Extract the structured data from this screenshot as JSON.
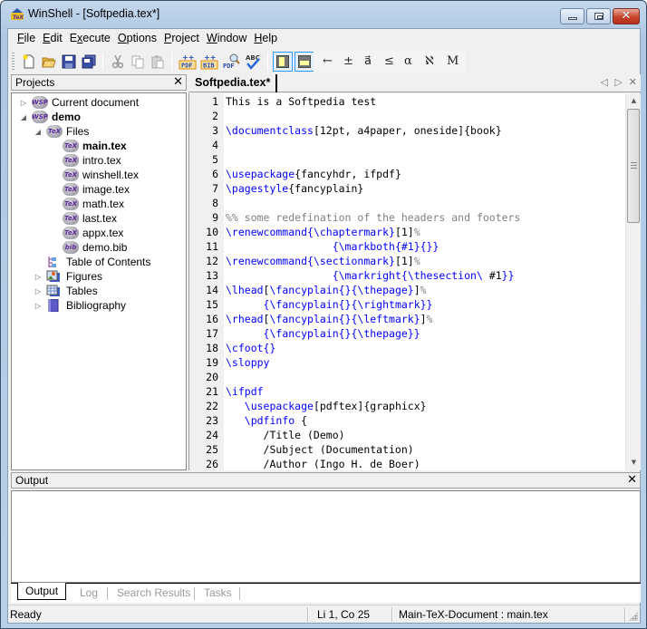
{
  "window": {
    "title": "WinShell - [Softpedia.tex*]",
    "app_icon": "winshell-tex-icon",
    "controls": {
      "minimize": "minimize",
      "maximize": "maximize",
      "close": "✕"
    }
  },
  "menubar": {
    "items": [
      {
        "accel": "F",
        "rest": "ile"
      },
      {
        "accel": "E",
        "rest": "dit"
      },
      {
        "pre": "E",
        "accel": "x",
        "rest": "ecute"
      },
      {
        "accel": "O",
        "rest": "ptions"
      },
      {
        "accel": "P",
        "rest": "roject"
      },
      {
        "accel": "W",
        "rest": "indow"
      },
      {
        "accel": "H",
        "rest": "elp"
      }
    ]
  },
  "toolbar": {
    "buttons": [
      {
        "name": "new-file",
        "icon": "new-file-icon"
      },
      {
        "name": "open-folder",
        "icon": "open-folder-icon"
      },
      {
        "name": "save",
        "icon": "save-icon"
      },
      {
        "name": "save-all",
        "icon": "save-all-icon"
      },
      {
        "name": "cut",
        "icon": "scissors-icon"
      },
      {
        "name": "copy",
        "icon": "copy-icon"
      },
      {
        "name": "paste",
        "icon": "paste-icon"
      },
      {
        "name": "pdflatex",
        "icon": "pdf-icon",
        "label": "PDF"
      },
      {
        "name": "bibtex",
        "icon": "bib-icon",
        "label": "BIB"
      },
      {
        "name": "pdf-view",
        "icon": "pdf-preview-icon",
        "label": "PDF"
      },
      {
        "name": "spell-check",
        "icon": "spellcheck-icon",
        "label": "ABC"
      },
      {
        "name": "toggle-project-panel",
        "icon": "panel-left-icon",
        "pressed": true
      },
      {
        "name": "toggle-output-panel",
        "icon": "panel-bottom-icon",
        "pressed": true
      }
    ],
    "symbols": [
      "←",
      "±",
      "a⃗",
      "≤",
      "α",
      "ℵ",
      "M"
    ]
  },
  "projects_panel": {
    "title": "Projects",
    "close": "✕",
    "tree": [
      {
        "label": "Current document",
        "icon": "wsp",
        "level": 0,
        "expander": "collapsed"
      },
      {
        "label": "demo",
        "icon": "wsp",
        "level": 0,
        "expander": "expanded",
        "bold": true
      },
      {
        "label": "Files",
        "icon": "tex",
        "level": 1,
        "expander": "expanded"
      },
      {
        "label": "main.tex",
        "icon": "tex",
        "level": 2,
        "bold": true
      },
      {
        "label": "intro.tex",
        "icon": "tex",
        "level": 2
      },
      {
        "label": "winshell.tex",
        "icon": "tex",
        "level": 2
      },
      {
        "label": "image.tex",
        "icon": "tex",
        "level": 2
      },
      {
        "label": "math.tex",
        "icon": "tex",
        "level": 2
      },
      {
        "label": "last.tex",
        "icon": "tex",
        "level": 2
      },
      {
        "label": "appx.tex",
        "icon": "tex",
        "level": 2
      },
      {
        "label": "demo.bib",
        "icon": "bib",
        "level": 2
      },
      {
        "label": "Table of Contents",
        "icon": "toc",
        "level": 1
      },
      {
        "label": "Figures",
        "icon": "figures",
        "level": 1,
        "expander": "collapsed"
      },
      {
        "label": "Tables",
        "icon": "tables",
        "level": 1,
        "expander": "collapsed"
      },
      {
        "label": "Bibliography",
        "icon": "bibliography",
        "level": 1,
        "expander": "collapsed"
      }
    ]
  },
  "editor": {
    "tab_label": "Softpedia.tex*",
    "nav": {
      "prev": "◁",
      "next": "▷",
      "close": "✕"
    },
    "lines": [
      {
        "n": "1",
        "parts": [
          [
            "t",
            "This is a Softpedia test"
          ]
        ]
      },
      {
        "n": "2",
        "parts": []
      },
      {
        "n": "3",
        "parts": [
          [
            "k",
            "\\documentclass"
          ],
          [
            "t",
            "[12pt, a4paper, oneside]{book}"
          ]
        ]
      },
      {
        "n": "4",
        "parts": []
      },
      {
        "n": "5",
        "parts": []
      },
      {
        "n": "6",
        "parts": [
          [
            "k",
            "\\usepackage"
          ],
          [
            "t",
            "{fancyhdr, ifpdf}"
          ]
        ]
      },
      {
        "n": "7",
        "parts": [
          [
            "k",
            "\\pagestyle"
          ],
          [
            "t",
            "{fancyplain}"
          ]
        ]
      },
      {
        "n": "8",
        "parts": []
      },
      {
        "n": "9",
        "parts": [
          [
            "c",
            "%% some redefination of the headers and footers"
          ]
        ]
      },
      {
        "n": "10",
        "parts": [
          [
            "k",
            "\\renewcommand{\\chaptermark}"
          ],
          [
            "t",
            "[1]"
          ],
          [
            "c",
            "%"
          ]
        ]
      },
      {
        "n": "11",
        "parts": [
          [
            "t",
            "                 "
          ],
          [
            "k",
            "{\\markboth{#1}{}}"
          ]
        ]
      },
      {
        "n": "12",
        "parts": [
          [
            "k",
            "\\renewcommand{\\sectionmark}"
          ],
          [
            "t",
            "[1]"
          ],
          [
            "c",
            "%"
          ]
        ]
      },
      {
        "n": "13",
        "parts": [
          [
            "t",
            "                 "
          ],
          [
            "k",
            "{\\markright{\\thesection\\ "
          ],
          [
            "t",
            "#1"
          ],
          [
            "k",
            "}}"
          ]
        ]
      },
      {
        "n": "14",
        "parts": [
          [
            "k",
            "\\lhead"
          ],
          [
            "t",
            "["
          ],
          [
            "k",
            "\\fancyplain{}{\\thepage}"
          ],
          [
            "t",
            "]"
          ],
          [
            "c",
            "%"
          ]
        ]
      },
      {
        "n": "15",
        "parts": [
          [
            "t",
            "      "
          ],
          [
            "k",
            "{\\fancyplain{}{\\rightmark}}"
          ]
        ]
      },
      {
        "n": "16",
        "parts": [
          [
            "k",
            "\\rhead"
          ],
          [
            "t",
            "["
          ],
          [
            "k",
            "\\fancyplain{}{\\leftmark}"
          ],
          [
            "t",
            "]"
          ],
          [
            "c",
            "%"
          ]
        ]
      },
      {
        "n": "17",
        "parts": [
          [
            "t",
            "      "
          ],
          [
            "k",
            "{\\fancyplain{}{\\thepage}}"
          ]
        ]
      },
      {
        "n": "18",
        "parts": [
          [
            "k",
            "\\cfoot{}"
          ]
        ]
      },
      {
        "n": "19",
        "parts": [
          [
            "k",
            "\\sloppy"
          ]
        ]
      },
      {
        "n": "20",
        "parts": []
      },
      {
        "n": "21",
        "parts": [
          [
            "k",
            "\\ifpdf"
          ]
        ]
      },
      {
        "n": "22",
        "parts": [
          [
            "t",
            "   "
          ],
          [
            "k",
            "\\usepackage"
          ],
          [
            "t",
            "[pdftex]{graphicx}"
          ]
        ]
      },
      {
        "n": "23",
        "parts": [
          [
            "t",
            "   "
          ],
          [
            "k",
            "\\pdfinfo"
          ],
          [
            "t",
            " {"
          ]
        ]
      },
      {
        "n": "24",
        "parts": [
          [
            "t",
            "      /Title (Demo)"
          ]
        ]
      },
      {
        "n": "25",
        "parts": [
          [
            "t",
            "      /Subject (Documentation)"
          ]
        ]
      },
      {
        "n": "26",
        "parts": [
          [
            "t",
            "      /Author (Ingo H. de Boer)"
          ]
        ]
      }
    ]
  },
  "output_panel": {
    "title": "Output",
    "close": "✕",
    "content": "",
    "tabs": [
      {
        "label": "Output",
        "active": true
      },
      {
        "label": "Log",
        "active": false
      },
      {
        "label": "Search Results",
        "active": false
      },
      {
        "label": "Tasks",
        "active": false
      }
    ]
  },
  "statusbar": {
    "status": "Ready",
    "position": "Li 1, Co 25",
    "main_document": "Main-TeX-Document :  main.tex"
  },
  "colors": {
    "keyword": "#0000ff",
    "comment": "#808080",
    "accent": "#3399ff",
    "tree_icon_text": "#5a2a9a"
  }
}
